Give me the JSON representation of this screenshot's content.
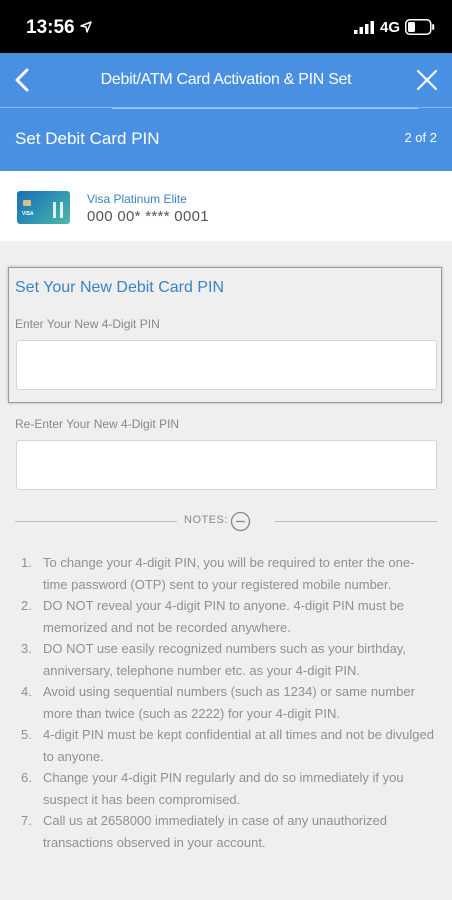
{
  "status_bar": {
    "time": "13:56",
    "network": "4G"
  },
  "nav": {
    "title": "Debit/ATM Card Activation & PIN Set"
  },
  "step": {
    "title": "Set Debit Card PIN",
    "count": "2 of 2"
  },
  "card": {
    "name": "Visa Platinum Elite",
    "number": "000 00* **** 0001",
    "brand_mark": "VISA"
  },
  "form": {
    "section_title": "Set Your New Debit Card PIN",
    "pin_label": "Enter Your New 4-Digit PIN",
    "pin_value": "",
    "reenter_label": "Re-Enter Your New 4-Digit PIN",
    "reenter_value": ""
  },
  "notes": {
    "label": "NOTES:",
    "items": [
      {
        "num": "1.",
        "text": "To change your 4-digit PIN, you will be required to enter the one-time password (OTP) sent to your registered mobile number."
      },
      {
        "num": "2.",
        "text": "DO NOT reveal your 4-digit PIN to anyone. 4-digit PIN must be memorized and not be recorded anywhere."
      },
      {
        "num": "3.",
        "text": "DO NOT use easily recognized numbers such as your birthday, anniversary, telephone number etc. as your 4-digit PIN."
      },
      {
        "num": "4.",
        "text": "Avoid using sequential numbers (such as 1234) or same number more than twice (such as 2222) for your 4-digit PIN."
      },
      {
        "num": "5.",
        "text": "4-digit PIN must be kept confidential at all times and not be divulged to anyone."
      },
      {
        "num": "6.",
        "text": "Change your 4-digit PIN regularly and do so immediately if you suspect it has been compromised."
      },
      {
        "num": "7.",
        "text": "Call us at 2658000 immediately in case of any unauthorized transactions observed in your account."
      }
    ]
  },
  "colors": {
    "primary": "#4a90e2",
    "link": "#3b82c4",
    "background": "#efefef"
  },
  "icons": {
    "back": "chevron-left-icon",
    "close": "close-icon",
    "notes_toggle": "minus-circle-icon",
    "location": "location-arrow-icon",
    "signal": "signal-icon",
    "battery": "battery-icon"
  }
}
